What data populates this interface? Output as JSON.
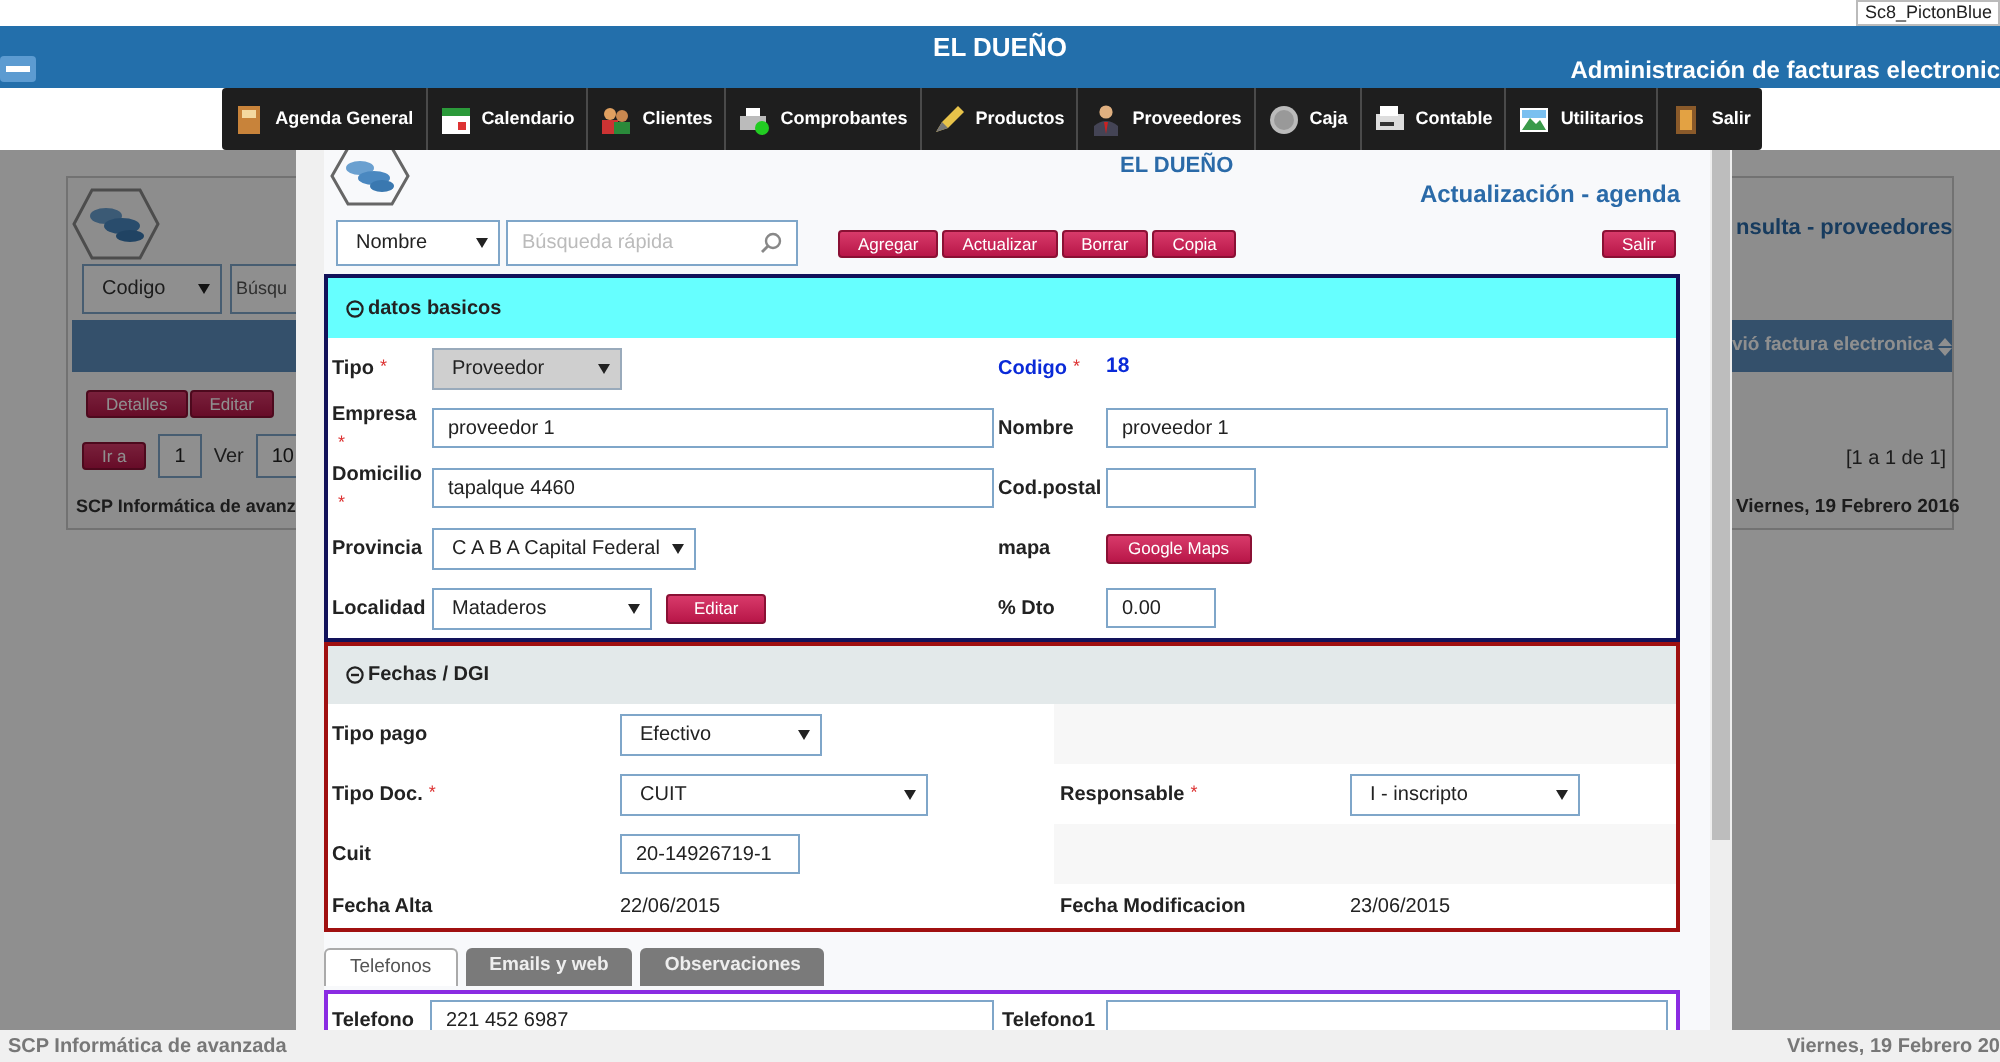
{
  "top_strip": {
    "label": "Sc8_PictonBlue"
  },
  "header": {
    "title": "EL DUEÑO",
    "subtitle": "Administración de facturas electronic"
  },
  "menu": [
    {
      "label": "Agenda General"
    },
    {
      "label": "Calendario"
    },
    {
      "label": "Clientes"
    },
    {
      "label": "Comprobantes"
    },
    {
      "label": "Productos"
    },
    {
      "label": "Proveedores"
    },
    {
      "label": "Caja"
    },
    {
      "label": "Contable"
    },
    {
      "label": "Utilitarios"
    },
    {
      "label": "Salir"
    }
  ],
  "background_page": {
    "search_by": "Codigo",
    "search_placeholder": "Búsqu",
    "title": "nsulta - proveedores",
    "column_header": "vió factura electronica",
    "row_buttons": [
      "Detalles",
      "Editar"
    ],
    "goto_button": "Ir a",
    "page_number": "1",
    "view_label": "Ver",
    "page_size": "10",
    "range": "[1 a 1 de 1]",
    "footer_left": "SCP Informática de avanz",
    "footer_right": "Viernes, 19 Febrero 2016"
  },
  "modal": {
    "title": "EL DUEÑO",
    "subtitle": "Actualización - agenda",
    "search": {
      "field": "Nombre",
      "placeholder": "Búsqueda rápida"
    },
    "actions": [
      "Agregar",
      "Actualizar",
      "Borrar",
      "Copia"
    ],
    "exit_button": "Salir",
    "basic_section": {
      "title": "datos basicos",
      "expanded": true,
      "rows": [
        {
          "left": {
            "label": "Tipo",
            "required_mark": "*",
            "kind": "select",
            "value": "Proveedor",
            "disabled": true
          },
          "right": {
            "label": "Codigo",
            "required_mark": "*",
            "kind": "code",
            "value": "18"
          }
        },
        {
          "left": {
            "label": "Empresa",
            "required_mark": "*",
            "kind": "input",
            "value": "proveedor 1",
            "disabled": false
          },
          "right": {
            "label": "Nombre",
            "kind": "input",
            "value": "proveedor 1",
            "disabled": false
          }
        },
        {
          "left": {
            "label": "Domicilio",
            "required_mark": "*",
            "kind": "input",
            "value": "tapalque 4460",
            "disabled": false
          },
          "right": {
            "label": "Cod.postal",
            "kind": "input",
            "disabled": false
          }
        },
        {
          "left": {
            "label": "Provincia",
            "kind": "select",
            "value": "C A B A Capital Federal",
            "disabled": false
          },
          "right": {
            "label": "mapa",
            "kind": "button",
            "value": "Google Maps"
          }
        },
        {
          "left": {
            "label": "Localidad",
            "kind": "select",
            "value": "Mataderos",
            "disabled": false,
            "action": "Editar"
          },
          "right": {
            "label": "% Dto",
            "kind": "input",
            "value": "0.00",
            "disabled": false
          }
        }
      ]
    },
    "dates_section": {
      "title": "Fechas / DGI",
      "expanded": true,
      "rows": [
        {
          "left": {
            "label": "Tipo pago",
            "kind": "select",
            "value": "Efectivo",
            "disabled": false
          }
        },
        {
          "left": {
            "label": "Tipo Doc.",
            "required_mark": "*",
            "kind": "select",
            "value": "CUIT",
            "disabled": false
          },
          "right": {
            "label": "Responsable",
            "required_mark": "*",
            "kind": "select",
            "value": "I - inscripto",
            "disabled": false
          }
        },
        {
          "left": {
            "label": "Cuit",
            "kind": "input",
            "value": "20-14926719-1",
            "disabled": false
          }
        },
        {
          "left": {
            "label": "Fecha Alta",
            "kind": "static",
            "value": "22/06/2015"
          },
          "right": {
            "label": "Fecha Modificacion",
            "kind": "static",
            "value": "23/06/2015"
          }
        }
      ]
    },
    "tabs": [
      {
        "label": "Telefonos",
        "selected": true
      },
      {
        "label": "Emails y web",
        "selected": false
      },
      {
        "label": "Observaciones",
        "selected": false
      }
    ],
    "phones": [
      {
        "label": "Telefono",
        "value": "221 452 6987"
      },
      {
        "label": "Telefono1"
      }
    ]
  },
  "footer": {
    "left": "SCP Informática de avanzada",
    "right": "Viernes, 19 Febrero 20"
  }
}
